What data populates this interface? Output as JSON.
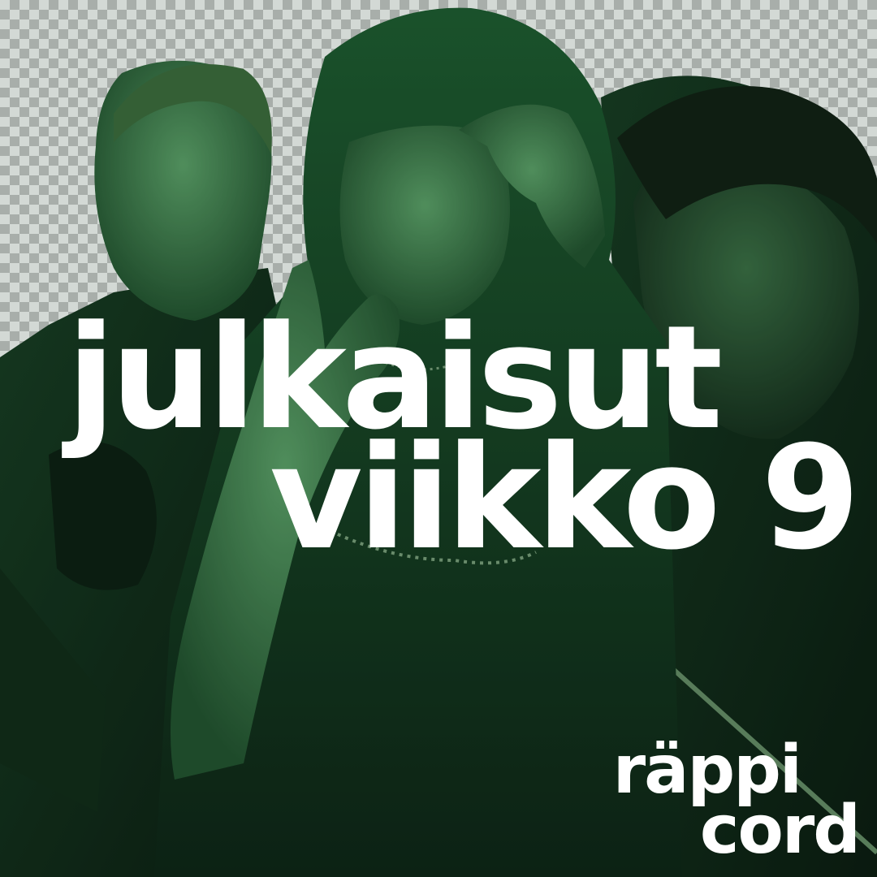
{
  "headline": {
    "line1": "julkaisut",
    "line2": "viikko 9"
  },
  "logo": {
    "line1": "räppi",
    "line2": "cord"
  },
  "colors": {
    "text": "#ffffff",
    "tint": "#1f6b3a",
    "shadow": "#0c1410"
  },
  "image": {
    "content": "three-artists-green-tint-photo",
    "background": "transparency-checkerboard"
  }
}
